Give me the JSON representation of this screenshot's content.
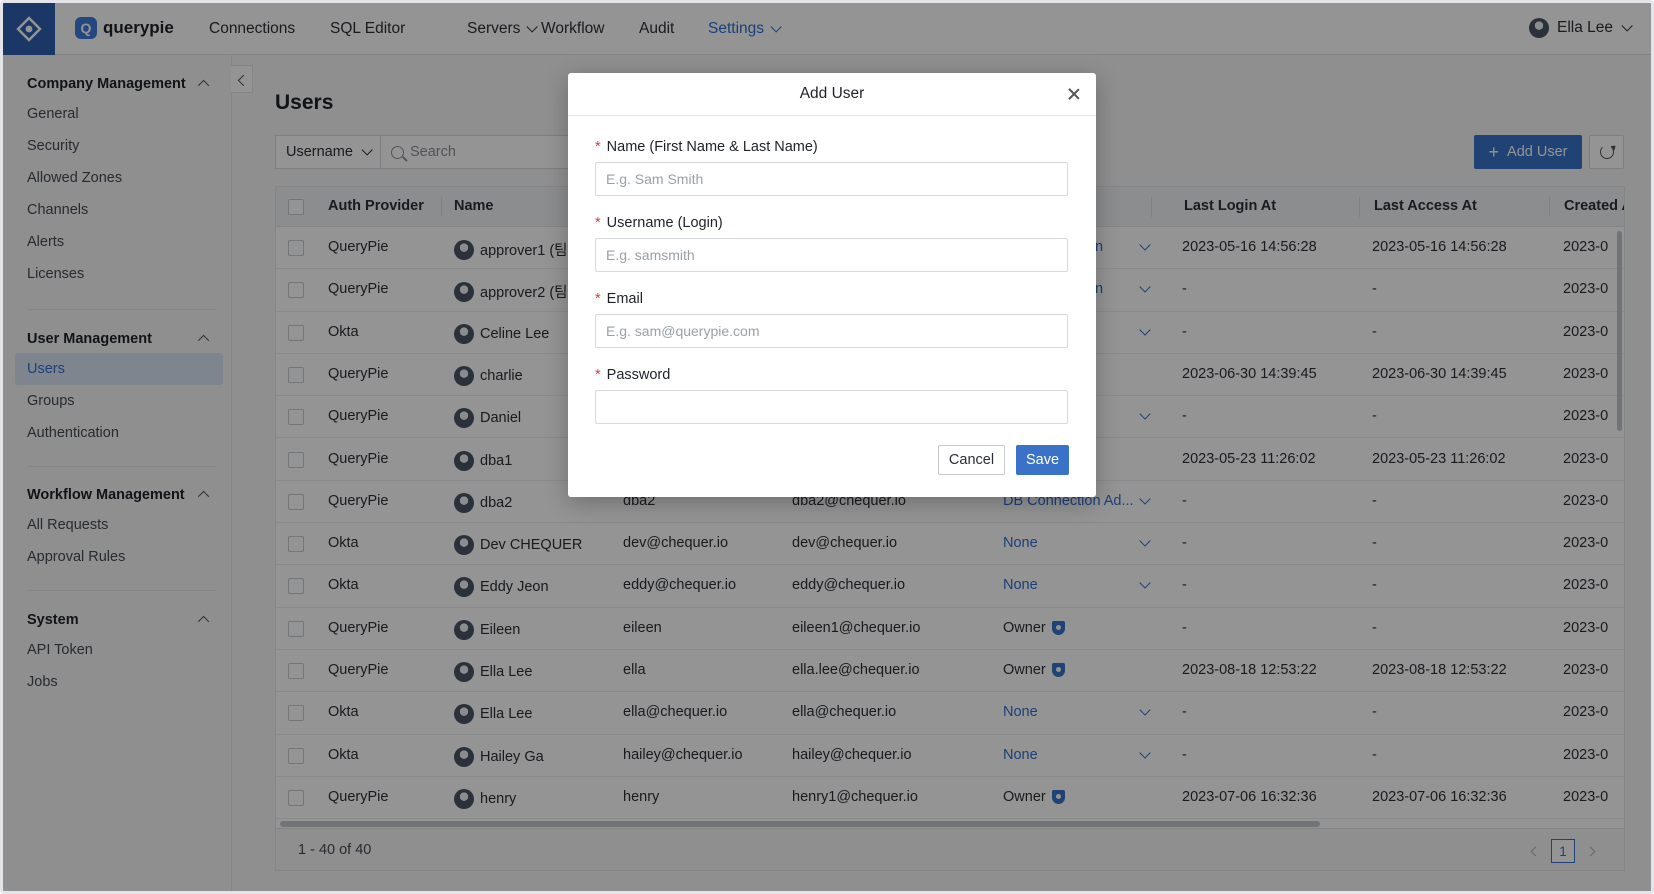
{
  "topnav": {
    "logo_letter": "Q",
    "logo_text": "querypie",
    "items": [
      {
        "label": "Connections"
      },
      {
        "label": "SQL Editor"
      },
      {
        "label": "Servers"
      },
      {
        "label": "Workflow"
      },
      {
        "label": "Audit"
      },
      {
        "label": "Settings"
      }
    ],
    "active_item": "Settings",
    "user_name": "Ella Lee"
  },
  "sidebar": {
    "sections": [
      {
        "title": "Company Management",
        "items": [
          "General",
          "Security",
          "Allowed Zones",
          "Channels",
          "Alerts",
          "Licenses"
        ]
      },
      {
        "title": "User Management",
        "items": [
          "Users",
          "Groups",
          "Authentication"
        ]
      },
      {
        "title": "Workflow Management",
        "items": [
          "All Requests",
          "Approval Rules"
        ]
      },
      {
        "title": "System",
        "items": [
          "API Token",
          "Jobs"
        ]
      }
    ],
    "active_item": "Users"
  },
  "main": {
    "title": "Users",
    "filter_value": "Username",
    "search_placeholder": "Search",
    "add_user_label": "Add User"
  },
  "table": {
    "columns": [
      "Auth Provider",
      "Name",
      "Last Login At",
      "Last Access At",
      "Created A"
    ],
    "rows": [
      {
        "provider": "QueryPie",
        "name": "approver1 (팀",
        "username": "",
        "email": "",
        "role": "n",
        "role_dropdown": true,
        "owner": false,
        "last_login": "2023-05-16 14:56:28",
        "last_access": "2023-05-16 14:56:28",
        "created": "2023-0"
      },
      {
        "provider": "QueryPie",
        "name": "approver2 (팀",
        "username": "",
        "email": "",
        "role": "n",
        "role_dropdown": true,
        "owner": false,
        "last_login": "-",
        "last_access": "-",
        "created": "2023-0"
      },
      {
        "provider": "Okta",
        "name": "Celine Lee",
        "username": "",
        "email": "",
        "role": "",
        "role_dropdown": true,
        "owner": false,
        "last_login": "-",
        "last_access": "-",
        "created": "2023-0"
      },
      {
        "provider": "QueryPie",
        "name": "charlie",
        "username": "",
        "email": "",
        "role": "",
        "role_dropdown": false,
        "owner": false,
        "last_login": "2023-06-30 14:39:45",
        "last_access": "2023-06-30 14:39:45",
        "created": "2023-0"
      },
      {
        "provider": "QueryPie",
        "name": "Daniel",
        "username": "",
        "email": "",
        "role": "",
        "role_dropdown": true,
        "owner": false,
        "last_login": "-",
        "last_access": "-",
        "created": "2023-0"
      },
      {
        "provider": "QueryPie",
        "name": "dba1",
        "username": "",
        "email": "",
        "role": "",
        "role_dropdown": false,
        "owner": false,
        "last_login": "2023-05-23 11:26:02",
        "last_access": "2023-05-23 11:26:02",
        "created": "2023-0"
      },
      {
        "provider": "QueryPie",
        "name": "dba2",
        "username": "dba2",
        "email": "dba2@chequer.io",
        "role": "DB Connection Ad...",
        "role_dropdown": true,
        "owner": false,
        "last_login": "-",
        "last_access": "-",
        "created": "2023-0"
      },
      {
        "provider": "Okta",
        "name": "Dev CHEQUER",
        "username": "dev@chequer.io",
        "email": "dev@chequer.io",
        "role": "None",
        "role_dropdown": true,
        "owner": false,
        "last_login": "-",
        "last_access": "-",
        "created": "2023-0"
      },
      {
        "provider": "Okta",
        "name": "Eddy Jeon",
        "username": "eddy@chequer.io",
        "email": "eddy@chequer.io",
        "role": "None",
        "role_dropdown": true,
        "owner": false,
        "last_login": "-",
        "last_access": "-",
        "created": "2023-0"
      },
      {
        "provider": "QueryPie",
        "name": "Eileen",
        "username": "eileen",
        "email": "eileen1@chequer.io",
        "role": "Owner",
        "role_dropdown": false,
        "owner": true,
        "last_login": "-",
        "last_access": "-",
        "created": "2023-0"
      },
      {
        "provider": "QueryPie",
        "name": "Ella Lee",
        "username": "ella",
        "email": "ella.lee@chequer.io",
        "role": "Owner",
        "role_dropdown": false,
        "owner": true,
        "last_login": "2023-08-18 12:53:22",
        "last_access": "2023-08-18 12:53:22",
        "created": "2023-0"
      },
      {
        "provider": "Okta",
        "name": "Ella Lee",
        "username": "ella@chequer.io",
        "email": "ella@chequer.io",
        "role": "None",
        "role_dropdown": true,
        "owner": false,
        "last_login": "-",
        "last_access": "-",
        "created": "2023-0"
      },
      {
        "provider": "Okta",
        "name": "Hailey Ga",
        "username": "hailey@chequer.io",
        "email": "hailey@chequer.io",
        "role": "None",
        "role_dropdown": true,
        "owner": false,
        "last_login": "-",
        "last_access": "-",
        "created": "2023-0"
      },
      {
        "provider": "QueryPie",
        "name": "henry",
        "username": "henry",
        "email": "henry1@chequer.io",
        "role": "Owner",
        "role_dropdown": false,
        "owner": true,
        "last_login": "2023-07-06 16:32:36",
        "last_access": "2023-07-06 16:32:36",
        "created": "2023-0"
      }
    ],
    "row_count": "1 - 40 of 40",
    "current_page": "1"
  },
  "modal": {
    "title": "Add User",
    "fields": [
      {
        "label": "Name (First Name & Last Name)",
        "placeholder": "E.g. Sam Smith",
        "value": ""
      },
      {
        "label": "Username (Login)",
        "placeholder": "E.g. samsmith",
        "value": ""
      },
      {
        "label": "Email",
        "placeholder": "E.g. sam@querypie.com",
        "value": ""
      },
      {
        "label": "Password",
        "placeholder": "",
        "value": ""
      }
    ],
    "required_mark": "*",
    "cancel_label": "Cancel",
    "save_label": "Save"
  },
  "colors": {
    "accent": "#3a72c8",
    "brand": "#2f5fb0",
    "link": "#2f6fd1",
    "required": "#d93a3a"
  }
}
